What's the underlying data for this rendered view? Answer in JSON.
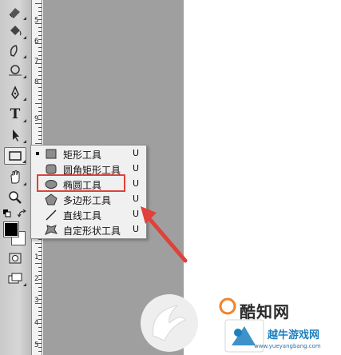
{
  "flyout": {
    "items": [
      {
        "label": "矩形工具",
        "shortcut": "U",
        "icon": "rectangle-shape-icon",
        "selected": true
      },
      {
        "label": "圆角矩形工具",
        "shortcut": "U",
        "icon": "rounded-rectangle-icon",
        "selected": false
      },
      {
        "label": "椭圆工具",
        "shortcut": "U",
        "icon": "ellipse-icon",
        "selected": false,
        "highlighted": true
      },
      {
        "label": "多边形工具",
        "shortcut": "U",
        "icon": "polygon-icon",
        "selected": false
      },
      {
        "label": "直线工具",
        "shortcut": "U",
        "icon": "line-icon",
        "selected": false
      },
      {
        "label": "自定形状工具",
        "shortcut": "U",
        "icon": "custom-shape-icon",
        "selected": false
      }
    ]
  },
  "toolbar": {
    "tools": [
      "eraser-icon",
      "paint-bucket-icon",
      "blur-icon",
      "dodge-icon",
      "pen-icon",
      "type-icon",
      "path-select-icon",
      "rectangle-tool-icon",
      "hand-icon",
      "zoom-icon",
      "quick-mask-icon",
      "screen-mode-icon"
    ],
    "type_glyph": "T",
    "foreground_color": "#000000",
    "background_color": "#ffffff"
  },
  "ruler": {
    "numbers": [
      "5",
      "6",
      "7",
      "8",
      "9",
      "1",
      "2",
      "3",
      "4",
      "5"
    ]
  },
  "annotation": {
    "highlight_color": "#e0413a"
  },
  "watermark": {
    "brand": "酷知网",
    "site": "越牛游戏网",
    "url": "www.yueyangbang.com"
  }
}
